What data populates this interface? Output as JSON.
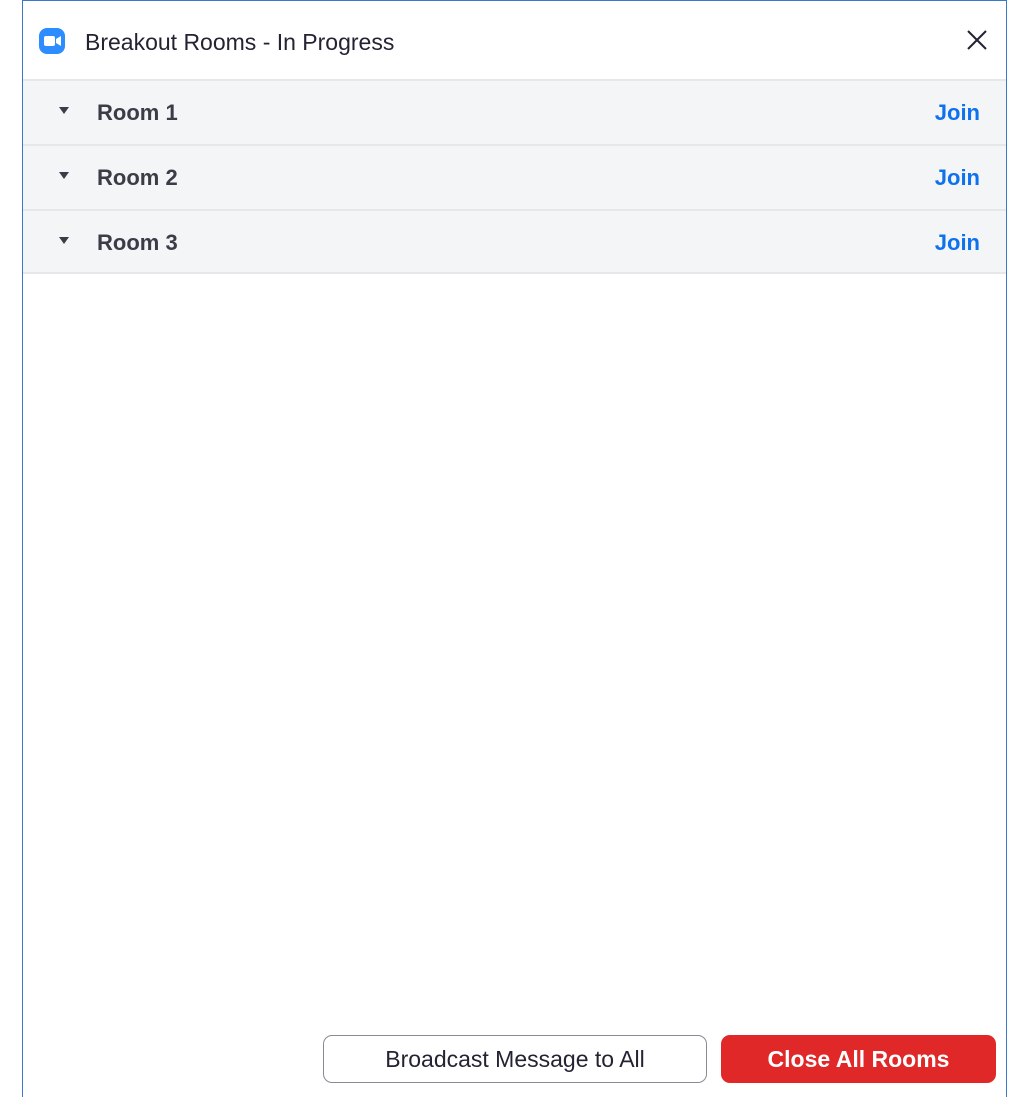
{
  "window": {
    "title": "Breakout Rooms - In Progress",
    "app_icon": "zoom-camera-icon",
    "close_icon": "close-icon"
  },
  "rooms": [
    {
      "name": "Room 1",
      "action": "Join"
    },
    {
      "name": "Room 2",
      "action": "Join"
    },
    {
      "name": "Room 3",
      "action": "Join"
    }
  ],
  "footer": {
    "broadcast_label": "Broadcast Message to All",
    "close_all_label": "Close All Rooms"
  },
  "colors": {
    "accent": "#0e72ed",
    "danger": "#e02828",
    "app_brand": "#2d8cff"
  }
}
